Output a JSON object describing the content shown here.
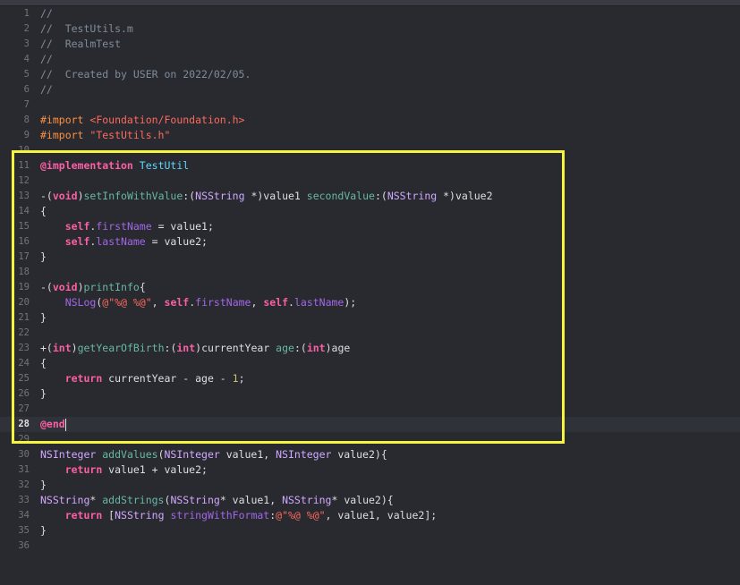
{
  "editor": {
    "lines": [
      {
        "n": "1",
        "tokens": [
          {
            "c": "t-comment",
            "t": "//"
          }
        ]
      },
      {
        "n": "2",
        "tokens": [
          {
            "c": "t-comment",
            "t": "//  TestUtils.m"
          }
        ]
      },
      {
        "n": "3",
        "tokens": [
          {
            "c": "t-comment",
            "t": "//  RealmTest"
          }
        ]
      },
      {
        "n": "4",
        "tokens": [
          {
            "c": "t-comment",
            "t": "//"
          }
        ]
      },
      {
        "n": "5",
        "tokens": [
          {
            "c": "t-comment",
            "t": "//  Created by USER on 2022/02/05."
          }
        ]
      },
      {
        "n": "6",
        "tokens": [
          {
            "c": "t-comment",
            "t": "//"
          }
        ]
      },
      {
        "n": "7",
        "tokens": []
      },
      {
        "n": "8",
        "tokens": [
          {
            "c": "t-preproc",
            "t": "#import "
          },
          {
            "c": "t-string",
            "t": "<Foundation/Foundation.h>"
          }
        ]
      },
      {
        "n": "9",
        "tokens": [
          {
            "c": "t-preproc",
            "t": "#import "
          },
          {
            "c": "t-string",
            "t": "\"TestUtils.h\""
          }
        ]
      },
      {
        "n": "10",
        "tokens": []
      },
      {
        "n": "11",
        "tokens": [
          {
            "c": "t-keyword",
            "t": "@implementation"
          },
          {
            "c": "t-plain",
            "t": " "
          },
          {
            "c": "t-classname",
            "t": "TestUtil"
          }
        ]
      },
      {
        "n": "12",
        "tokens": []
      },
      {
        "n": "13",
        "tokens": [
          {
            "c": "t-plain",
            "t": "-("
          },
          {
            "c": "t-keyword",
            "t": "void"
          },
          {
            "c": "t-plain",
            "t": ")"
          },
          {
            "c": "t-method",
            "t": "setInfoWithValue"
          },
          {
            "c": "t-plain",
            "t": ":("
          },
          {
            "c": "t-type",
            "t": "NSString"
          },
          {
            "c": "t-plain",
            "t": " *)value1 "
          },
          {
            "c": "t-method",
            "t": "secondValue"
          },
          {
            "c": "t-plain",
            "t": ":("
          },
          {
            "c": "t-type",
            "t": "NSString"
          },
          {
            "c": "t-plain",
            "t": " *)value2"
          }
        ]
      },
      {
        "n": "14",
        "tokens": [
          {
            "c": "t-plain",
            "t": "{"
          }
        ]
      },
      {
        "n": "15",
        "tokens": [
          {
            "c": "t-plain",
            "t": "    "
          },
          {
            "c": "t-keyword",
            "t": "self"
          },
          {
            "c": "t-plain",
            "t": "."
          },
          {
            "c": "t-selfprop",
            "t": "firstName"
          },
          {
            "c": "t-plain",
            "t": " = value1;"
          }
        ]
      },
      {
        "n": "16",
        "tokens": [
          {
            "c": "t-plain",
            "t": "    "
          },
          {
            "c": "t-keyword",
            "t": "self"
          },
          {
            "c": "t-plain",
            "t": "."
          },
          {
            "c": "t-selfprop",
            "t": "lastName"
          },
          {
            "c": "t-plain",
            "t": " = value2;"
          }
        ]
      },
      {
        "n": "17",
        "tokens": [
          {
            "c": "t-plain",
            "t": "}"
          }
        ]
      },
      {
        "n": "18",
        "tokens": []
      },
      {
        "n": "19",
        "tokens": [
          {
            "c": "t-plain",
            "t": "-("
          },
          {
            "c": "t-keyword",
            "t": "void"
          },
          {
            "c": "t-plain",
            "t": ")"
          },
          {
            "c": "t-method",
            "t": "printInfo"
          },
          {
            "c": "t-plain",
            "t": "{"
          }
        ]
      },
      {
        "n": "20",
        "tokens": [
          {
            "c": "t-plain",
            "t": "    "
          },
          {
            "c": "t-sysfunc",
            "t": "NSLog"
          },
          {
            "c": "t-plain",
            "t": "("
          },
          {
            "c": "t-string",
            "t": "@\"%@ %@\""
          },
          {
            "c": "t-plain",
            "t": ", "
          },
          {
            "c": "t-keyword",
            "t": "self"
          },
          {
            "c": "t-plain",
            "t": "."
          },
          {
            "c": "t-selfprop",
            "t": "firstName"
          },
          {
            "c": "t-plain",
            "t": ", "
          },
          {
            "c": "t-keyword",
            "t": "self"
          },
          {
            "c": "t-plain",
            "t": "."
          },
          {
            "c": "t-selfprop",
            "t": "lastName"
          },
          {
            "c": "t-plain",
            "t": ");"
          }
        ]
      },
      {
        "n": "21",
        "tokens": [
          {
            "c": "t-plain",
            "t": "}"
          }
        ]
      },
      {
        "n": "22",
        "tokens": []
      },
      {
        "n": "23",
        "tokens": [
          {
            "c": "t-plain",
            "t": "+("
          },
          {
            "c": "t-keyword",
            "t": "int"
          },
          {
            "c": "t-plain",
            "t": ")"
          },
          {
            "c": "t-method",
            "t": "getYearOfBirth"
          },
          {
            "c": "t-plain",
            "t": ":("
          },
          {
            "c": "t-keyword",
            "t": "int"
          },
          {
            "c": "t-plain",
            "t": ")currentYear "
          },
          {
            "c": "t-method",
            "t": "age"
          },
          {
            "c": "t-plain",
            "t": ":("
          },
          {
            "c": "t-keyword",
            "t": "int"
          },
          {
            "c": "t-plain",
            "t": ")age"
          }
        ]
      },
      {
        "n": "24",
        "tokens": [
          {
            "c": "t-plain",
            "t": "{"
          }
        ]
      },
      {
        "n": "25",
        "tokens": [
          {
            "c": "t-plain",
            "t": "    "
          },
          {
            "c": "t-keyword",
            "t": "return"
          },
          {
            "c": "t-plain",
            "t": " currentYear - age - "
          },
          {
            "c": "t-number",
            "t": "1"
          },
          {
            "c": "t-plain",
            "t": ";"
          }
        ]
      },
      {
        "n": "26",
        "tokens": [
          {
            "c": "t-plain",
            "t": "}"
          }
        ]
      },
      {
        "n": "27",
        "tokens": []
      },
      {
        "n": "28",
        "current": true,
        "tokens": [
          {
            "c": "t-keyword",
            "t": "@end"
          }
        ]
      },
      {
        "n": "29",
        "tokens": []
      },
      {
        "n": "30",
        "tokens": [
          {
            "c": "t-type",
            "t": "NSInteger"
          },
          {
            "c": "t-plain",
            "t": " "
          },
          {
            "c": "t-projfunc",
            "t": "addValues"
          },
          {
            "c": "t-plain",
            "t": "("
          },
          {
            "c": "t-type",
            "t": "NSInteger"
          },
          {
            "c": "t-plain",
            "t": " value1, "
          },
          {
            "c": "t-type",
            "t": "NSInteger"
          },
          {
            "c": "t-plain",
            "t": " value2){"
          }
        ]
      },
      {
        "n": "31",
        "tokens": [
          {
            "c": "t-plain",
            "t": "    "
          },
          {
            "c": "t-keyword",
            "t": "return"
          },
          {
            "c": "t-plain",
            "t": " value1 + value2;"
          }
        ]
      },
      {
        "n": "32",
        "tokens": [
          {
            "c": "t-plain",
            "t": "}"
          }
        ]
      },
      {
        "n": "33",
        "tokens": [
          {
            "c": "t-type",
            "t": "NSString"
          },
          {
            "c": "t-plain",
            "t": "* "
          },
          {
            "c": "t-projfunc",
            "t": "addStrings"
          },
          {
            "c": "t-plain",
            "t": "("
          },
          {
            "c": "t-type",
            "t": "NSString"
          },
          {
            "c": "t-plain",
            "t": "* value1, "
          },
          {
            "c": "t-type",
            "t": "NSString"
          },
          {
            "c": "t-plain",
            "t": "* value2){"
          }
        ]
      },
      {
        "n": "34",
        "tokens": [
          {
            "c": "t-plain",
            "t": "    "
          },
          {
            "c": "t-keyword",
            "t": "return"
          },
          {
            "c": "t-plain",
            "t": " ["
          },
          {
            "c": "t-type",
            "t": "NSString"
          },
          {
            "c": "t-plain",
            "t": " "
          },
          {
            "c": "t-sysfunc",
            "t": "stringWithFormat"
          },
          {
            "c": "t-plain",
            "t": ":"
          },
          {
            "c": "t-string",
            "t": "@\"%@ %@\""
          },
          {
            "c": "t-plain",
            "t": ", value1, value2];"
          }
        ]
      },
      {
        "n": "35",
        "tokens": [
          {
            "c": "t-plain",
            "t": "}"
          }
        ]
      },
      {
        "n": "36",
        "tokens": []
      }
    ]
  },
  "colors": {
    "background": "#292a30",
    "highlight_box": "#f5f53d",
    "keyword": "#fc5fa3",
    "comment": "#7f8c98",
    "string": "#fc6a5d",
    "preprocessor": "#fd8f3f",
    "type": "#d0a8ff",
    "method": "#67b7a4",
    "class_name": "#5dd8ff",
    "number": "#d0bf69"
  }
}
